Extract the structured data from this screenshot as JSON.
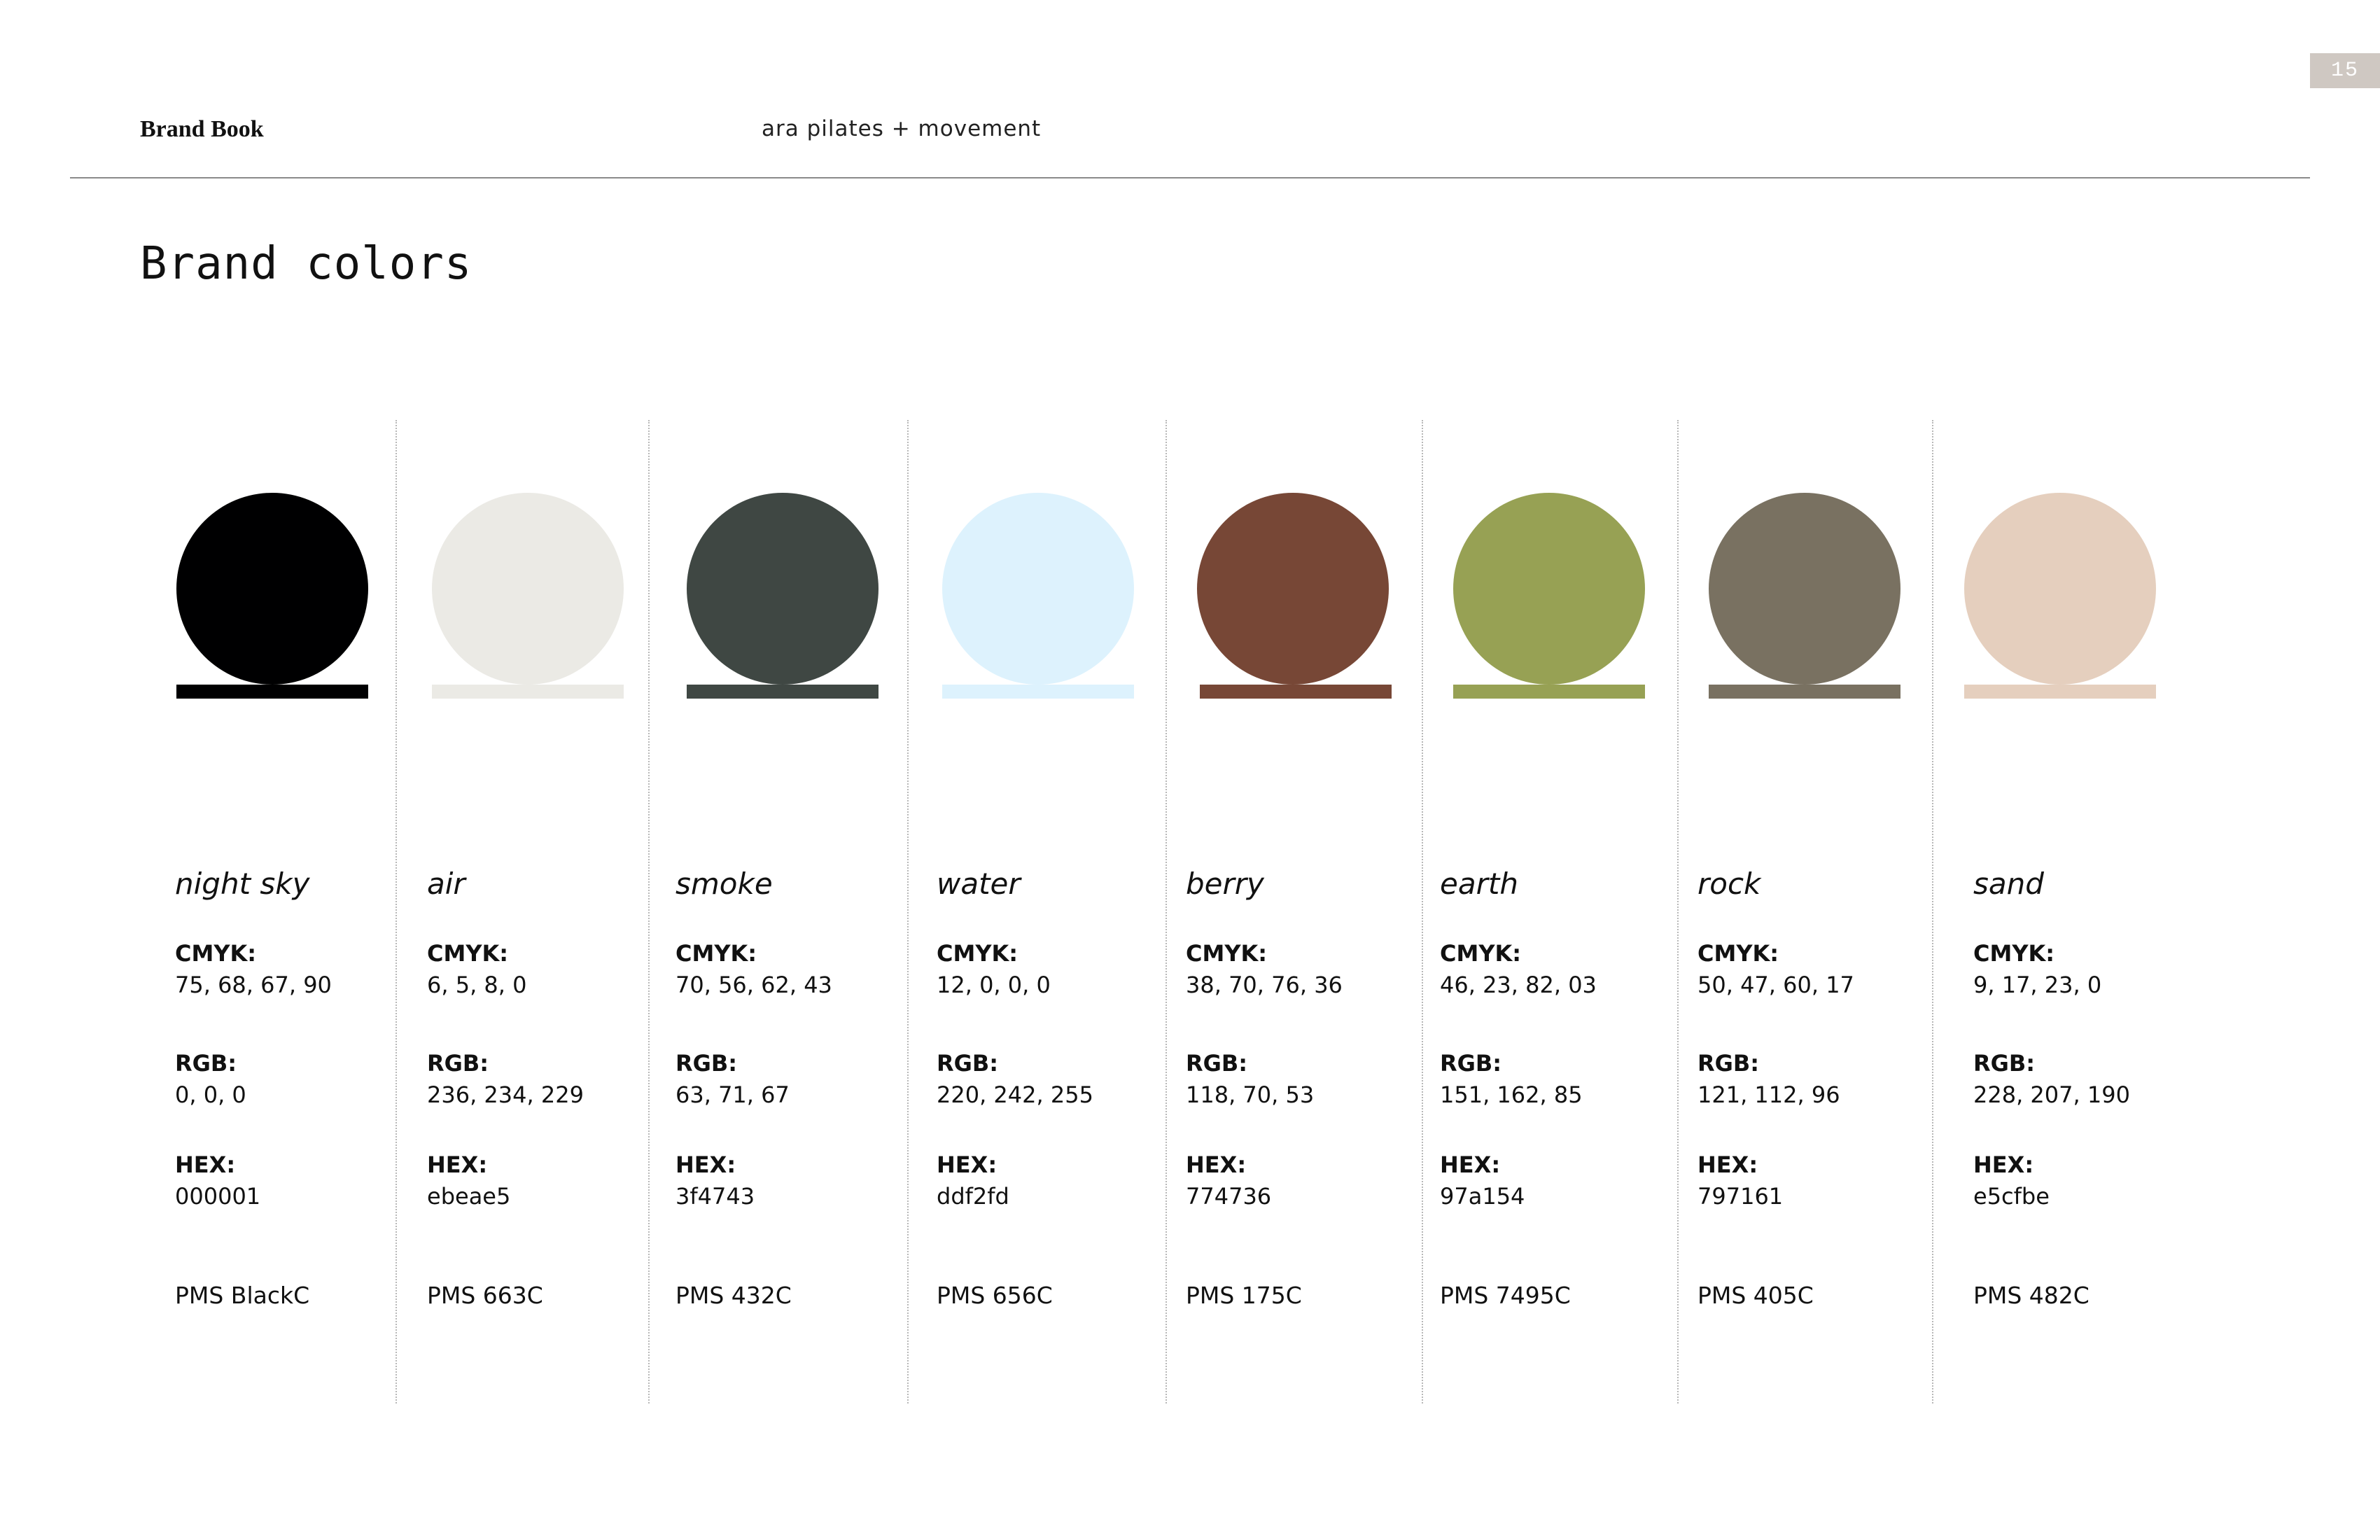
{
  "header": {
    "brand_book": "Brand Book",
    "studio": "ara pilates + movement",
    "page_number": "15"
  },
  "title": "Brand colors",
  "labels": {
    "cmyk": "CMYK:",
    "rgb": "RGB:",
    "hex": "HEX:"
  },
  "colors": [
    {
      "name": "night sky",
      "cmyk": "75, 68, 67, 90",
      "rgb": "0, 0, 0",
      "hex": "000001",
      "pms": "PMS BlackC",
      "swatch": "#000001"
    },
    {
      "name": "air",
      "cmyk": "6, 5, 8, 0",
      "rgb": "236, 234, 229",
      "hex": "ebeae5",
      "pms": "PMS 663C",
      "swatch": "#ebeae5"
    },
    {
      "name": "smoke",
      "cmyk": "70, 56, 62, 43",
      "rgb": "63, 71, 67",
      "hex": "3f4743",
      "pms": "PMS 432C",
      "swatch": "#3f4743"
    },
    {
      "name": "water",
      "cmyk": "12, 0, 0, 0",
      "rgb": "220, 242, 255",
      "hex": "ddf2fd",
      "pms": "PMS 656C",
      "swatch": "#ddf2fd"
    },
    {
      "name": "berry",
      "cmyk": "38, 70, 76, 36",
      "rgb": "118, 70, 53",
      "hex": "774736",
      "pms": "PMS 175C",
      "swatch": "#774736"
    },
    {
      "name": "earth",
      "cmyk": "46, 23, 82, 03",
      "rgb": "151, 162, 85",
      "hex": "97a154",
      "pms": "PMS 7495C",
      "swatch": "#97a154"
    },
    {
      "name": "rock",
      "cmyk": "50, 47, 60, 17",
      "rgb": "121, 112, 96",
      "hex": "797161",
      "pms": "PMS 405C",
      "swatch": "#797161"
    },
    {
      "name": "sand",
      "cmyk": "9, 17, 23, 0",
      "rgb": "228, 207, 190",
      "hex": "e5cfbe",
      "pms": "PMS 482C",
      "swatch": "#e5cfbe"
    }
  ]
}
